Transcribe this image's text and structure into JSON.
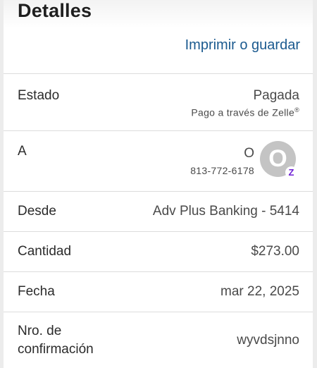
{
  "header": {
    "title": "Detalles",
    "print_label": "Imprimir o guardar"
  },
  "status": {
    "label": "Estado",
    "value": "Pagada",
    "sub": "Pago a través de Zelle",
    "sub_mark": "®"
  },
  "recipient": {
    "label": "A",
    "name": "O",
    "phone": "813-772-6178",
    "avatar_letter": "O",
    "badge_icon": "zelle-icon",
    "badge_glyph": "Z",
    "badge_color": "#6d1ed4"
  },
  "from": {
    "label": "Desde",
    "value": "Adv Plus Banking - 5414"
  },
  "amount": {
    "label": "Cantidad",
    "value": "$273.00"
  },
  "date": {
    "label": "Fecha",
    "value": "mar 22, 2025"
  },
  "confirmation": {
    "label": "Nro. de confirmación",
    "value": "wyvdsjnno"
  },
  "colors": {
    "link": "#1b5a8f",
    "avatar_bg": "#c4c4c4"
  }
}
